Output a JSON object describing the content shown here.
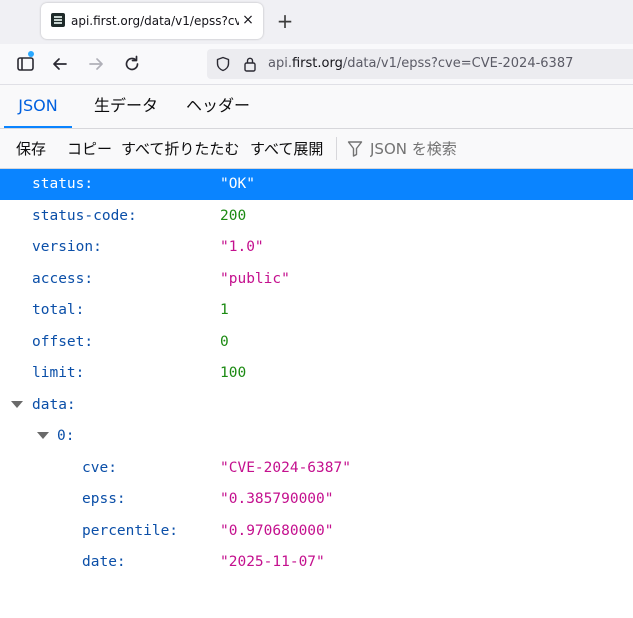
{
  "tab": {
    "title": "api.first.org/data/v1/epss?cve=CVE-2024-6387",
    "close_icon": "×",
    "new_tab_icon": "+"
  },
  "url": {
    "scheme_prefix": "api.",
    "host": "first.org",
    "path": "/data/v1/epss?cve=CVE-2024-6387"
  },
  "viewer_tabs": [
    {
      "label": "JSON",
      "active": true
    },
    {
      "label": "生データ",
      "active": false
    },
    {
      "label": "ヘッダー",
      "active": false
    }
  ],
  "toolbar": {
    "save": "保存",
    "copy": "コピー",
    "collapse_all": "すべて折りたたむ",
    "expand_all": "すべて展開",
    "filter_placeholder": "JSON を検索"
  },
  "json": {
    "status": {
      "key": "status:",
      "value": "\"OK\""
    },
    "status_code": {
      "key": "status-code:",
      "value": "200"
    },
    "version": {
      "key": "version:",
      "value": "\"1.0\""
    },
    "access": {
      "key": "access:",
      "value": "\"public\""
    },
    "total": {
      "key": "total:",
      "value": "1"
    },
    "offset": {
      "key": "offset:",
      "value": "0"
    },
    "limit": {
      "key": "limit:",
      "value": "100"
    },
    "data": {
      "key": "data:"
    },
    "item0": {
      "key": "0:"
    },
    "cve": {
      "key": "cve:",
      "value": "\"CVE-2024-6387\""
    },
    "epss": {
      "key": "epss:",
      "value": "\"0.385790000\""
    },
    "percentile": {
      "key": "percentile:",
      "value": "\"0.970680000\""
    },
    "date": {
      "key": "date:",
      "value": "\"2025-11-07\""
    }
  },
  "colors": {
    "accent": "#0a84ff",
    "string": "#c4108e",
    "number": "#1b8a12",
    "key": "#0b4fa8"
  }
}
